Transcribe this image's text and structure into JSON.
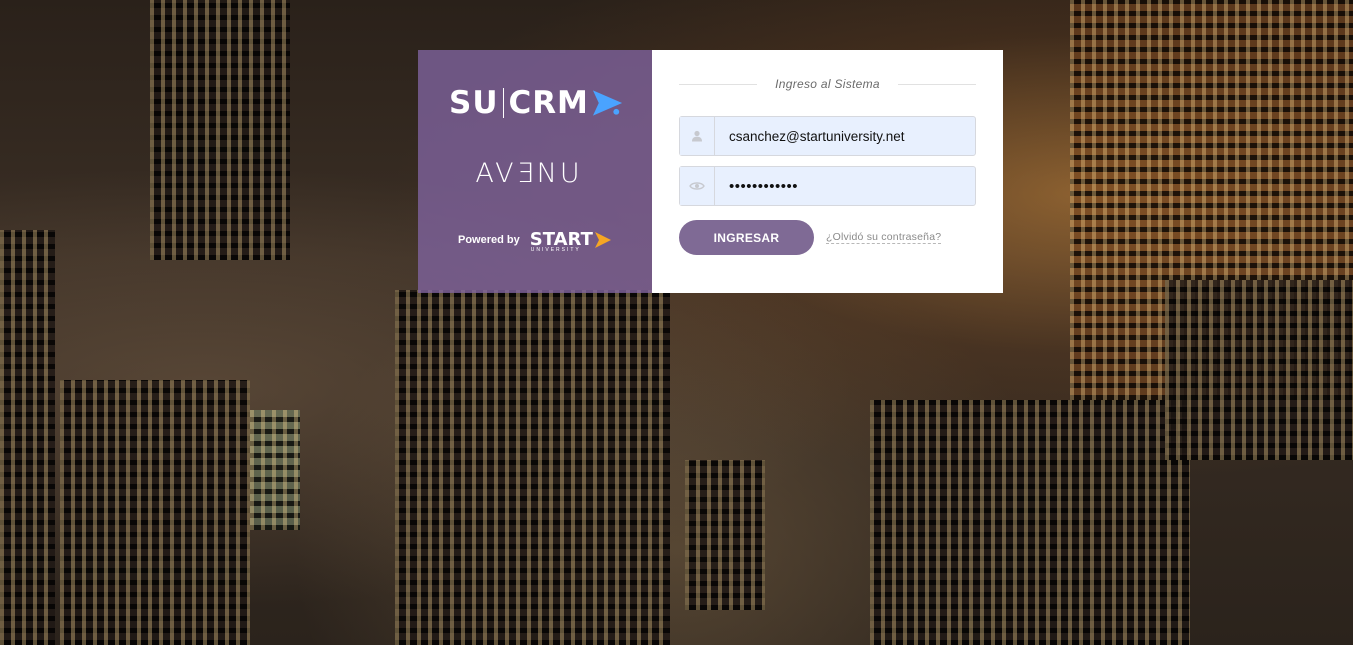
{
  "brand": {
    "logo_text_left": "SU",
    "logo_text_right": "CRM",
    "product_name": "AVƎNU",
    "powered_by_label": "Powered by",
    "start_logo_text": "START",
    "start_logo_sub": "UNIVERSITY",
    "accent_color": "#4aa3ff",
    "start_accent_color": "#f5a623",
    "panel_color": "#8064a0"
  },
  "login": {
    "title": "Ingreso al Sistema",
    "email_value": "csanchez@startuniversity.net",
    "password_value": "••••••••••••",
    "user_icon": "user-icon",
    "eye_icon": "eye-icon",
    "submit_label": "INGRESAR",
    "forgot_link": "¿Olvidó su contraseña?",
    "button_color": "#7f6a95"
  }
}
